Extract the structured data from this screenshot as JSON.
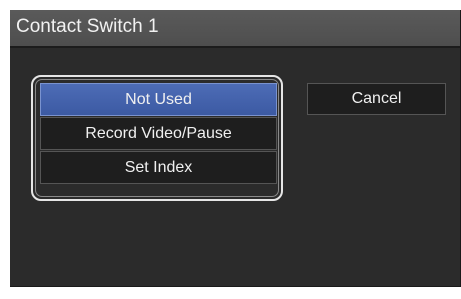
{
  "dialog": {
    "title": "Contact Switch 1"
  },
  "menu": {
    "items": [
      {
        "label": "Not Used",
        "selected": true
      },
      {
        "label": "Record Video/Pause",
        "selected": false
      },
      {
        "label": "Set Index",
        "selected": false
      }
    ]
  },
  "actions": {
    "cancel_label": "Cancel"
  },
  "colors": {
    "selected_item": "#4462ad",
    "dialog_background": "#2b2b2b",
    "titlebar_background": "#555555"
  }
}
